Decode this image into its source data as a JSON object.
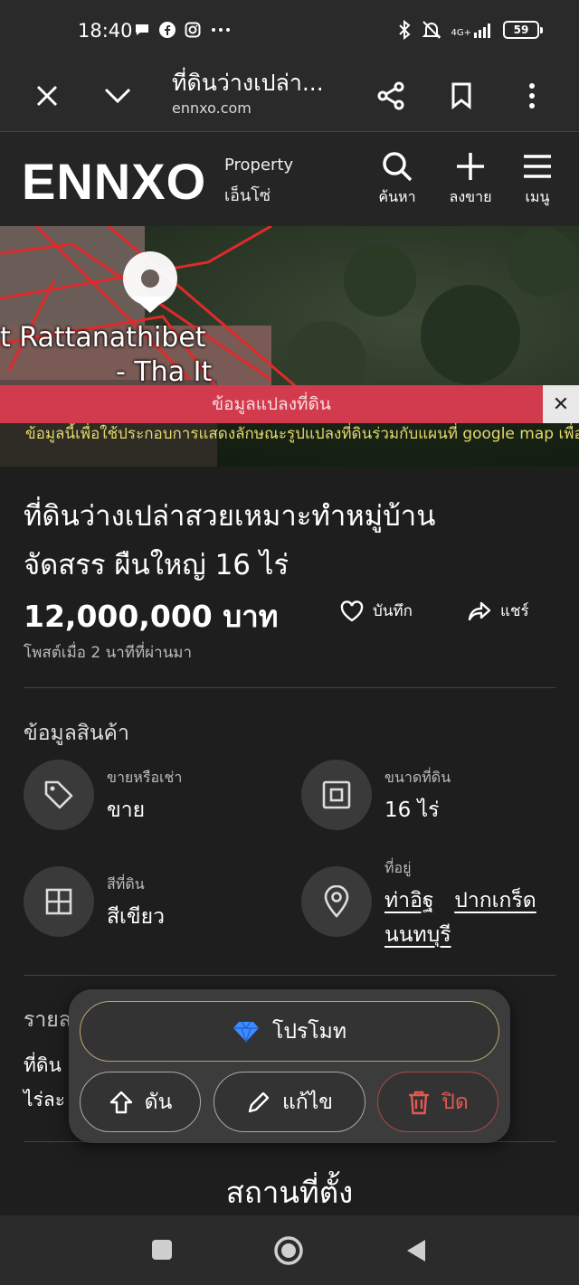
{
  "status": {
    "time": "18:40",
    "battery": "59",
    "network": "4G+"
  },
  "browser": {
    "title": "ที่ดินว่างเปล่า...",
    "url": "ennxo.com"
  },
  "header": {
    "logo": "ENNXO",
    "logo_sub1": "Property",
    "logo_sub2": "เอ็นโซ่",
    "search_label": "ค้นหา",
    "post_label": "ลงขาย",
    "menu_label": "เมนู"
  },
  "map": {
    "place_label_1": "t Rattanathibet",
    "place_label_2": "- Tha It",
    "banner": "ข้อมูลแปลงที่ดิน",
    "close": "✕",
    "note": "ข้อมูลนี้เพื่อใช้ประกอบการแสดงลักษณะรูปแปลงที่ดินร่วมกับแผนที่ google map เพื่อดูสภาพพื้นที่เท่านั้น มิใช่หลักฐานที่ใช้ในทางกฎหมาย หากมีข้อสงสัย"
  },
  "listing": {
    "title_line1": "ที่ดินว่างเปล่าสวยเหมาะทำหมู่บ้าน",
    "title_line2": "จัดสรร ผืนใหญ่ 16 ไร่",
    "price": "12,000,000 บาท",
    "save_label": "บันทึก",
    "share_label": "แชร์",
    "posted": "โพสต์เมื่อ 2 นาทีที่ผ่านมา"
  },
  "info": {
    "section_title": "ข้อมูลสินค้า",
    "sale_type_label": "ขายหรือเช่า",
    "sale_type_value": "ขาย",
    "land_size_label": "ขนาดที่ดิน",
    "land_size_value": "16 ไร่",
    "zone_color_label": "สีที่ดิน",
    "zone_color_value": "สีเขียว",
    "address_label": "ที่อยู่",
    "address_subdistrict": "ท่าอิฐ",
    "address_district": "ปากเกร็ด",
    "address_province": "นนทบุรี"
  },
  "description": {
    "heading": "รายล",
    "line1": "ที่ดิน",
    "line2": "ไร่ละ"
  },
  "location_title": "สถานที่ตั้ง",
  "panel": {
    "promote": "โปรโมท",
    "bump": "ดัน",
    "edit": "แก้ไข",
    "close": "ปิด"
  },
  "colors": {
    "banner": "#d23b4d",
    "close_red": "#e05b52",
    "diamond": "#3d8bff",
    "background": "#1e1e1e"
  }
}
